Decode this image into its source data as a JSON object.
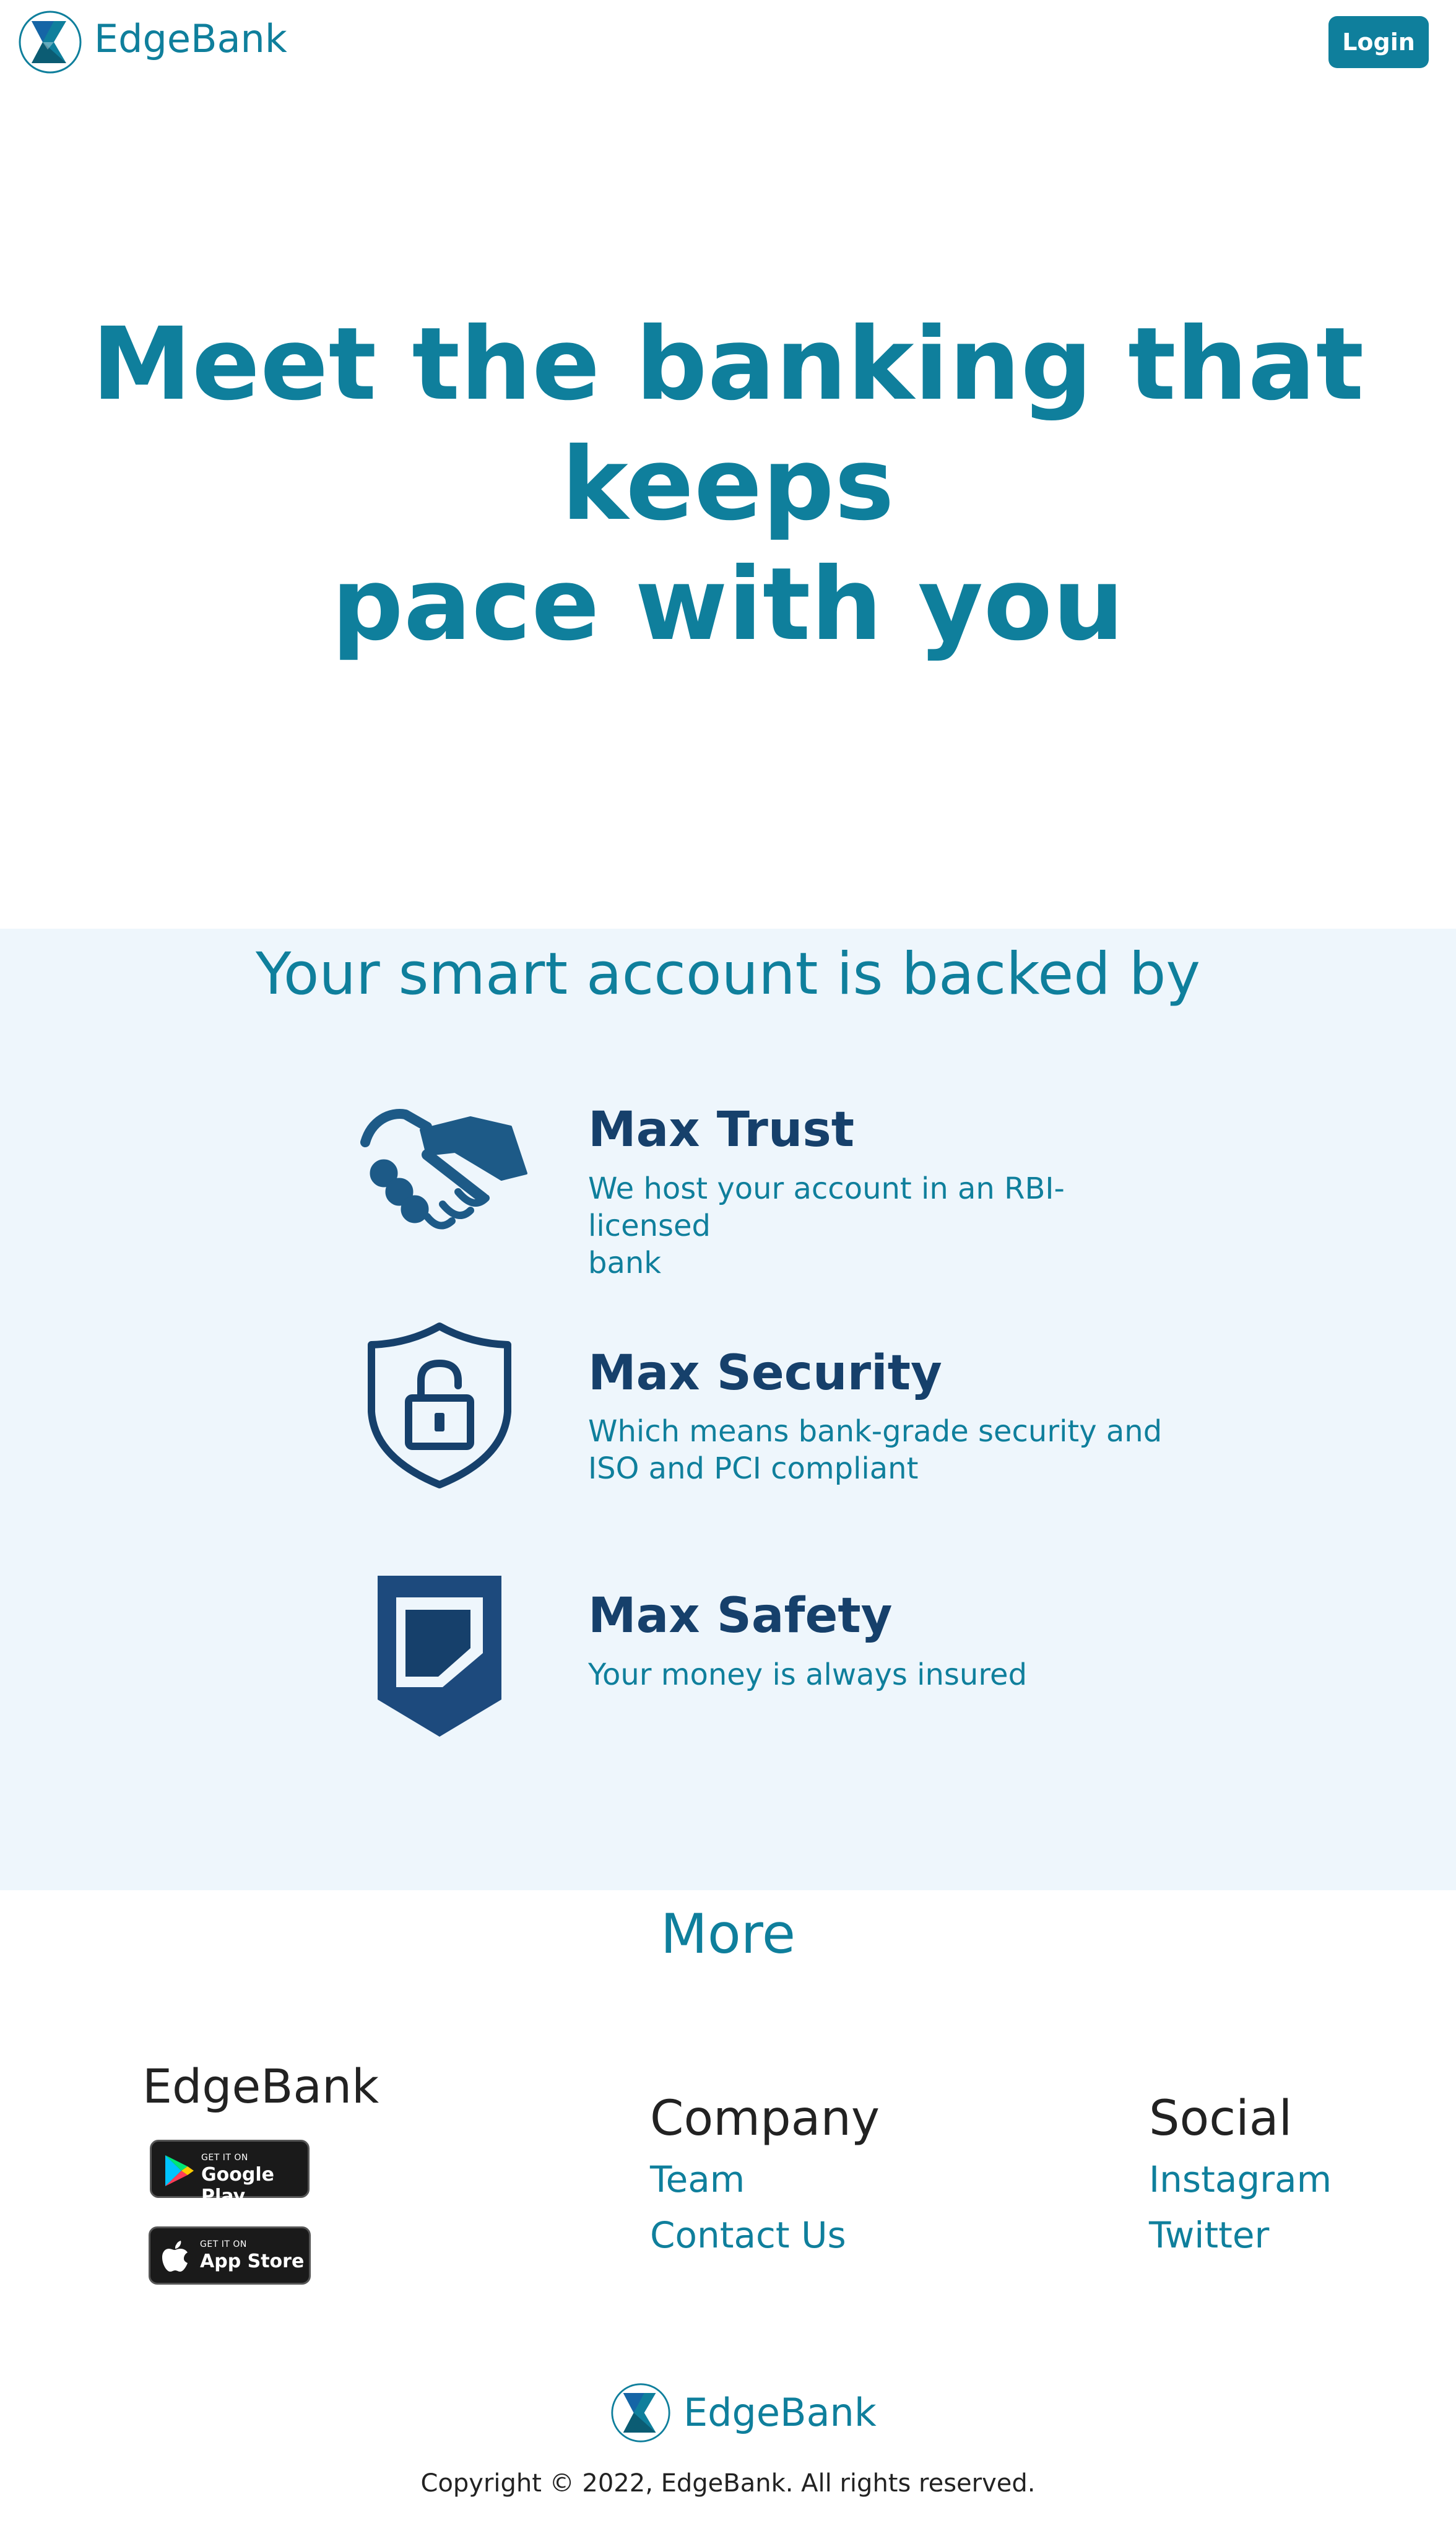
{
  "header": {
    "brand": "EdgeBank",
    "login_label": "Login"
  },
  "hero": {
    "title_line1": "Meet the banking that keeps",
    "title_line2": "pace with you"
  },
  "backed_by": {
    "title": "Your smart account is backed by",
    "features": [
      {
        "icon": "handshake-icon",
        "title": "Max Trust",
        "desc_line1": "We host your account in an RBI-licensed",
        "desc_line2": "bank"
      },
      {
        "icon": "shield-lock-icon",
        "title": "Max Security",
        "desc_line1": "Which means bank-grade security and",
        "desc_line2": "ISO and PCI compliant"
      },
      {
        "icon": "shield-badge-icon",
        "title": "Max Safety",
        "desc_line1": "Your money is always insured",
        "desc_line2": ""
      }
    ]
  },
  "more": {
    "title": "More"
  },
  "footer": {
    "brand": "EdgeBank",
    "google_play": {
      "small": "GET IT ON",
      "big": "Google Play"
    },
    "app_store": {
      "small": "GET IT ON",
      "big": "App Store"
    },
    "company": {
      "heading": "Company",
      "links": [
        "Team",
        "Contact Us"
      ]
    },
    "social": {
      "heading": "Social",
      "links": [
        "Instagram",
        "Twitter"
      ]
    },
    "bottom_brand": "EdgeBank",
    "copyright": "Copyright © 2022, EdgeBank. All rights reserved."
  },
  "colors": {
    "primary": "#0f7f9c",
    "navy": "#16406b",
    "section_bg": "#eef6fc"
  }
}
